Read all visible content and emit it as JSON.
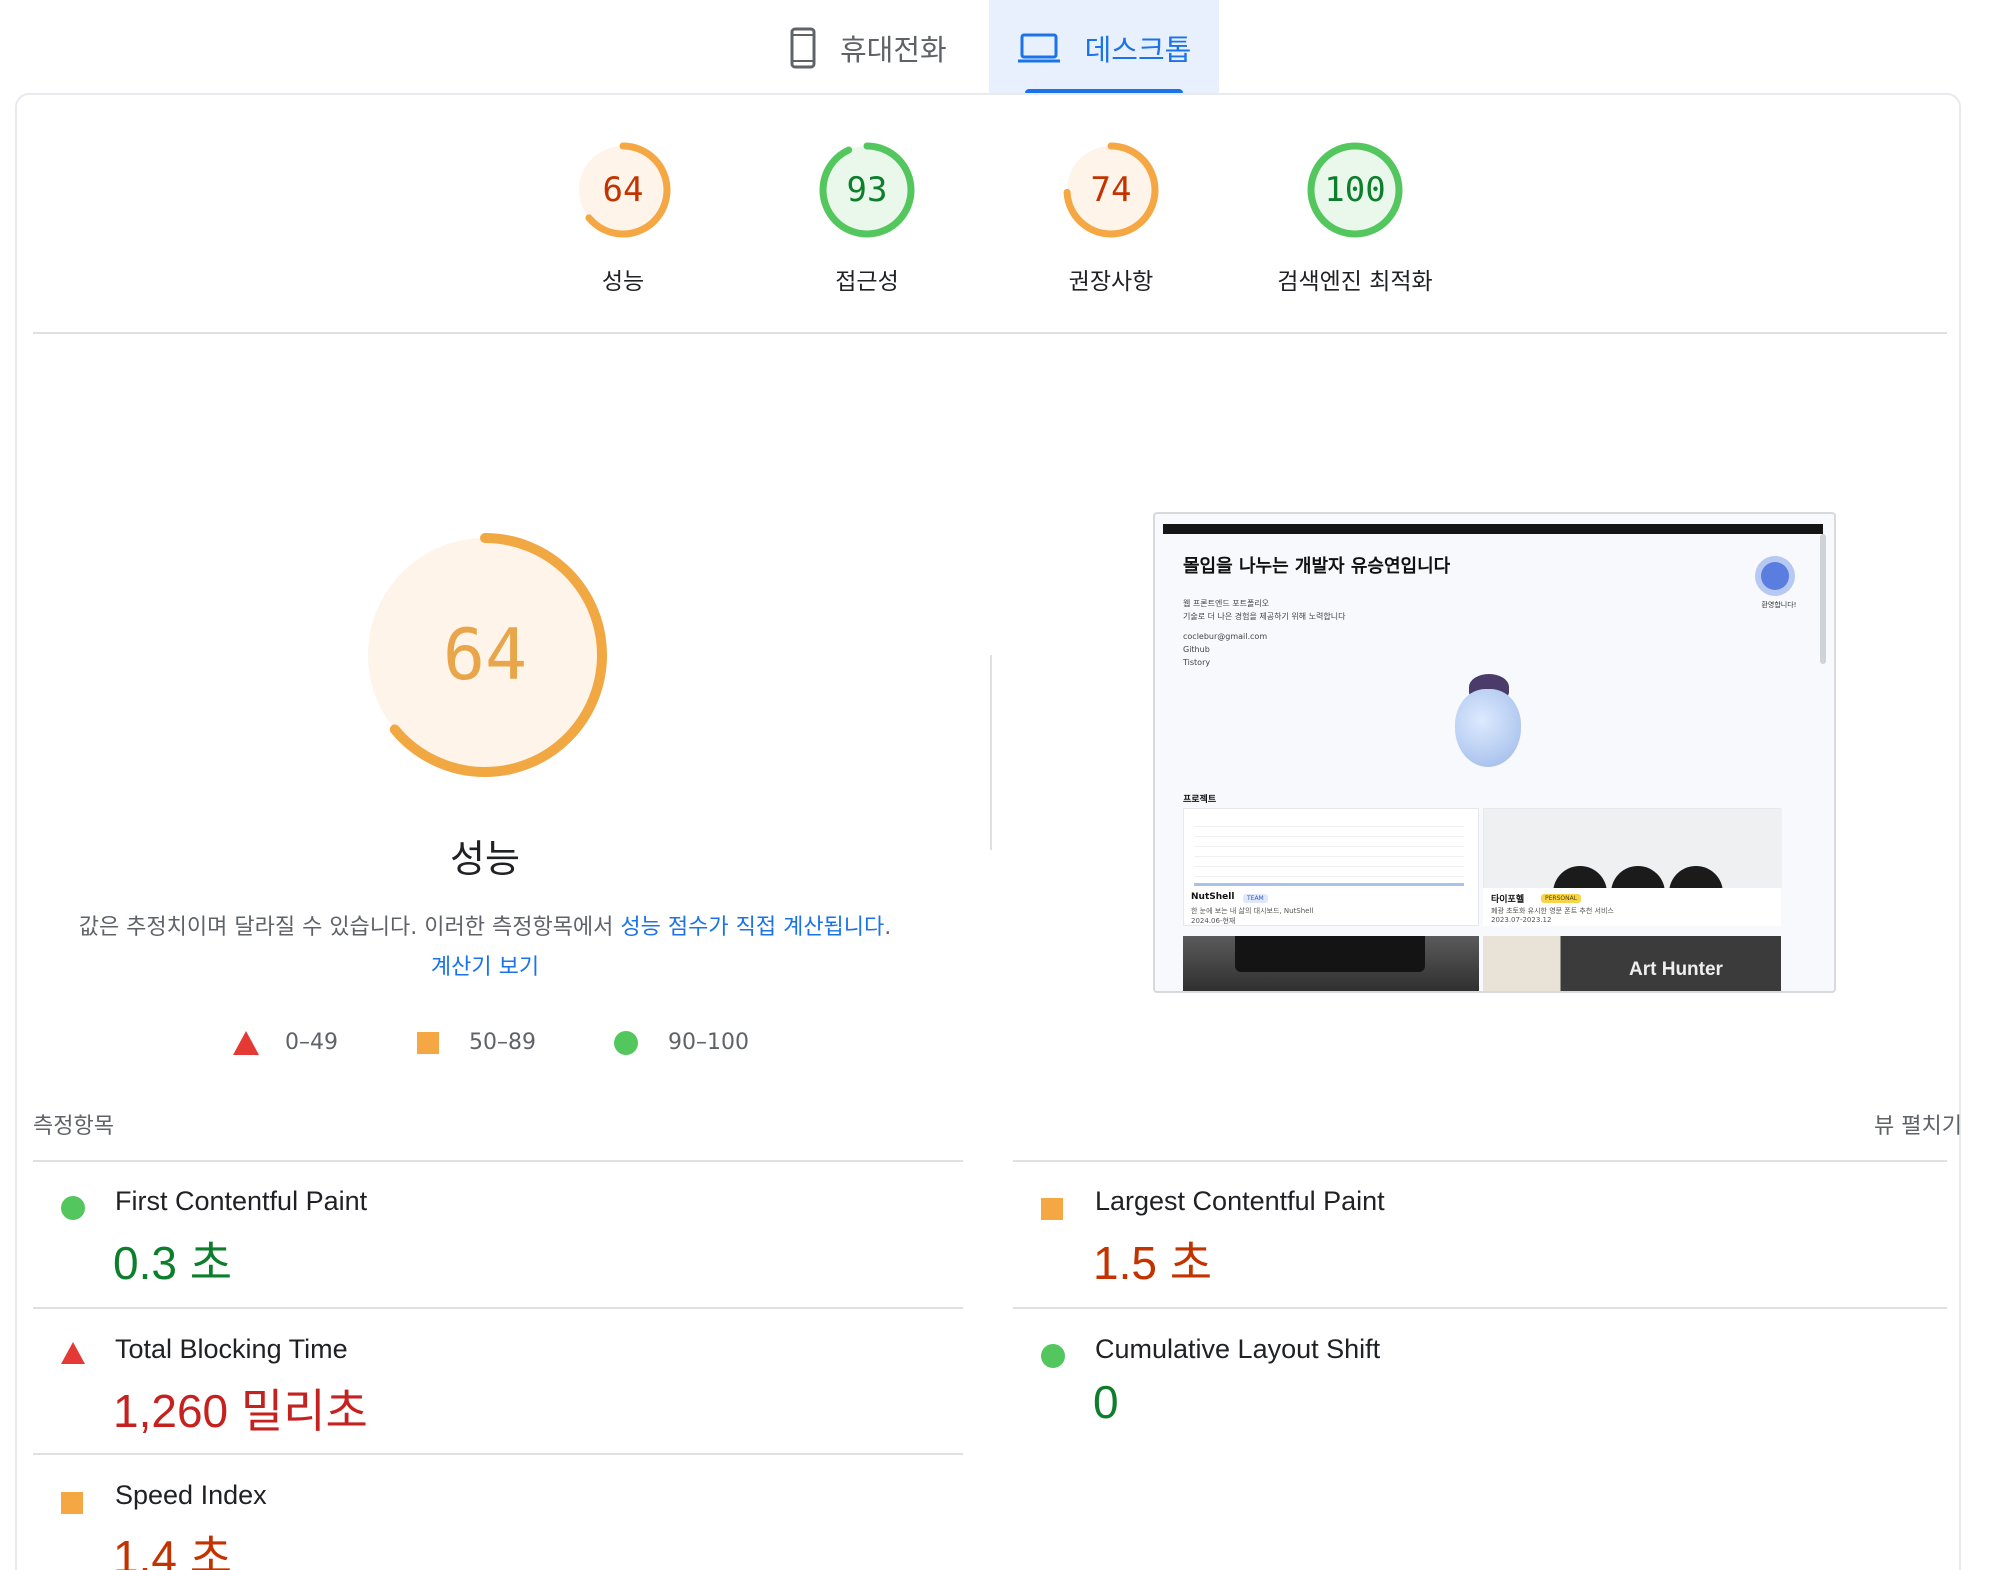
{
  "tabs": {
    "mobile": "휴대전화",
    "desktop": "데스크톱"
  },
  "scores": [
    {
      "value": "64",
      "label": "성능",
      "status": "average",
      "color": "#f4a742"
    },
    {
      "value": "93",
      "label": "접근성",
      "status": "pass",
      "color": "#53c65d"
    },
    {
      "value": "74",
      "label": "권장사항",
      "status": "average",
      "color": "#f4a742"
    },
    {
      "value": "100",
      "label": "검색엔진 최적화",
      "status": "pass",
      "color": "#53c65d"
    }
  ],
  "performance": {
    "score": "64",
    "title": "성능",
    "desc_text": "값은 추정치이며 달라질 수 있습니다. 이러한 측정항목에서 ",
    "desc_link1": "성능 점수가 직접 계산됩니",
    "desc_link1_cont": "다",
    "desc_sep": ". ",
    "desc_link2": "계산기 보기",
    "legend": [
      {
        "range": "0–49",
        "shape": "triangle",
        "color": "#e53935"
      },
      {
        "range": "50–89",
        "shape": "square",
        "color": "#f4a742"
      },
      {
        "range": "90–100",
        "shape": "circle",
        "color": "#53c65d"
      }
    ]
  },
  "screenshot": {
    "title": "몰입을 나누는 개발자 유승연입니다",
    "line1": "웹 프론트엔드 포트폴리오",
    "line2": "기술로 더 나은 경험을 제공하기 위해 노력합니다",
    "email": "coclebur@gmail.com",
    "link1": "Github",
    "link2": "Tistory",
    "visitors": "환영합니다!",
    "section": "프로젝트",
    "card1_title": "NutShell",
    "card1_badge": "TEAM",
    "card1_desc": "한 눈에 보는 내 삶의 대시보드, NutShell",
    "card1_date": "2024.06-현재",
    "card2_title": "타이포헬",
    "card2_badge": "PERSONAL",
    "card2_desc": "폐광 초토화 유시한 영문 폰트 추천 서비스",
    "card2_date": "2023.07-2023.12",
    "card4_title": "Art Hunter"
  },
  "metrics": {
    "header": "측정항목",
    "expand": "뷰 펼치기",
    "items": [
      {
        "name": "First Contentful Paint",
        "value": "0.3 초",
        "status": "pass"
      },
      {
        "name": "Largest Contentful Paint",
        "value": "1.5 초",
        "status": "average"
      },
      {
        "name": "Total Blocking Time",
        "value": "1,260 밀리초",
        "status": "fail"
      },
      {
        "name": "Cumulative Layout Shift",
        "value": "0",
        "status": "pass"
      },
      {
        "name": "Speed Index",
        "value": "1.4 초",
        "status": "average"
      }
    ]
  },
  "colors": {
    "accent": "#1a73e8",
    "pass": "#0d7e2c",
    "average_text": "#c33300",
    "fail_text": "#c5221f"
  }
}
